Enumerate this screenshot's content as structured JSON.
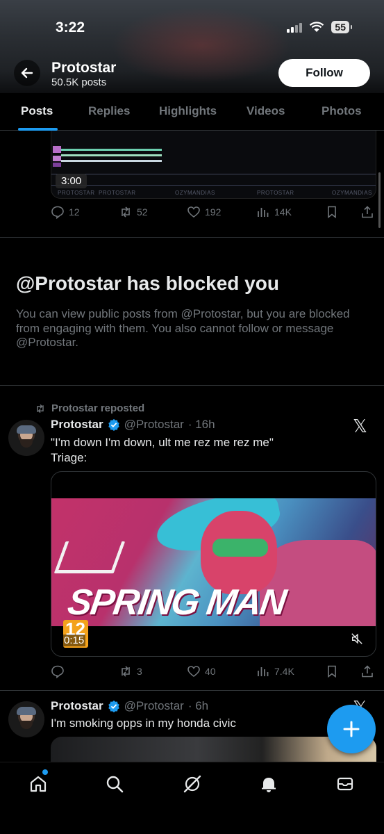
{
  "status_bar": {
    "time": "3:22",
    "battery": "55"
  },
  "header": {
    "name": "Protostar",
    "posts_count": "50.5K posts",
    "follow_label": "Follow"
  },
  "tabs": [
    {
      "label": "Posts",
      "active": true
    },
    {
      "label": "Replies"
    },
    {
      "label": "Highlights"
    },
    {
      "label": "Videos"
    },
    {
      "label": "Photos"
    }
  ],
  "top_post": {
    "video_duration": "3:00",
    "strip_labels": [
      "PROTOSTAR",
      "OZYMANDIAS",
      "PROTOSTAR",
      "OZYMANDIAS"
    ],
    "replies": "12",
    "reposts": "52",
    "likes": "192",
    "views": "14K"
  },
  "blocked": {
    "title": "@Protostar has blocked you",
    "message": "You can view public posts from @Protostar, but you are blocked from engaging with them. You also cannot follow or message @Protostar."
  },
  "post1": {
    "repost_label": "Protostar reposted",
    "name": "Protostar",
    "handle": "@Protostar",
    "time": "· 16h",
    "line1": "\"I'm down I'm down, ult me rez me rez me\"",
    "line2": "Triage:",
    "media_title": "SPRING MAN",
    "age_rating": "12",
    "media_duration": "0:15",
    "replies": "",
    "reposts": "3",
    "likes": "40",
    "views": "7.4K"
  },
  "post2": {
    "name": "Protostar",
    "handle": "@Protostar",
    "time": "· 6h",
    "text": "I'm smoking opps in my honda civic"
  },
  "colors": {
    "accent": "#1d9bf0",
    "muted": "#71767b",
    "text": "#e7e9ea",
    "background": "#000000"
  }
}
